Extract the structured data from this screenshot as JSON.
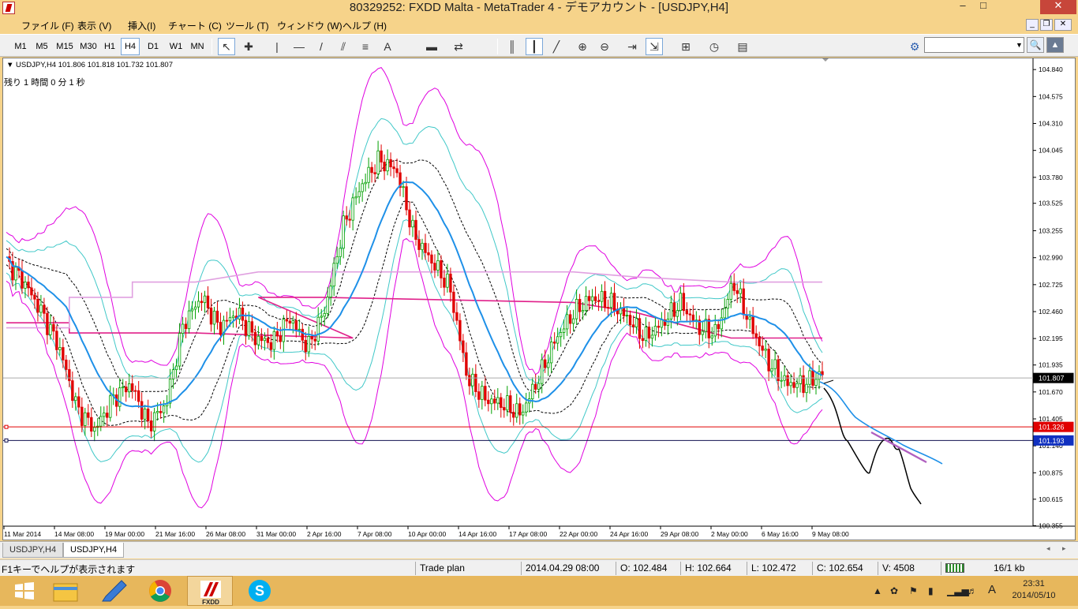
{
  "window": {
    "title": "80329252: FXDD Malta - MetaTrader 4 - デモアカウント - [USDJPY,H4]",
    "app_icon": "mt4-app-icon",
    "controls": {
      "minimize": "‒",
      "maximize": "□",
      "close": "✕",
      "restore": "⇅"
    }
  },
  "menu": {
    "items": [
      "ファイル (F)",
      "表示 (V)",
      "挿入(I)",
      "チャート (C)",
      "ツール (T)",
      "ウィンドウ (W)",
      "ヘルプ (H)"
    ],
    "mdi_controls": [
      "_",
      "❐",
      "✕"
    ]
  },
  "toolbar": {
    "timeframes": [
      "M1",
      "M5",
      "M15",
      "M30",
      "H1",
      "H4",
      "D1",
      "W1",
      "MN"
    ],
    "active_timeframe": "H4",
    "tools": [
      {
        "icon": "cursor-icon",
        "glyph": "↖"
      },
      {
        "icon": "crosshair-icon",
        "glyph": "✚"
      },
      {
        "icon": "vertical-line-icon",
        "glyph": "|"
      },
      {
        "icon": "horizontal-line-icon",
        "glyph": "—"
      },
      {
        "icon": "trendline-icon",
        "glyph": "/"
      },
      {
        "icon": "equidistant-channel-icon",
        "glyph": "⫽"
      },
      {
        "icon": "fibonacci-icon",
        "glyph": "≡"
      },
      {
        "icon": "text-icon",
        "glyph": "A"
      },
      {
        "icon": "text-label-icon",
        "glyph": "▬"
      },
      {
        "icon": "arrows-icon",
        "glyph": "⇄"
      }
    ],
    "chart_tools": [
      {
        "icon": "bar-chart-icon",
        "glyph": "║"
      },
      {
        "icon": "candlestick-icon",
        "glyph": "┃"
      },
      {
        "icon": "line-chart-icon",
        "glyph": "╱"
      },
      {
        "icon": "zoom-in-icon",
        "glyph": "⊕"
      },
      {
        "icon": "zoom-out-icon",
        "glyph": "⊖"
      },
      {
        "icon": "auto-scroll-icon",
        "glyph": "⇥"
      },
      {
        "icon": "chart-shift-icon",
        "glyph": "⇲"
      },
      {
        "icon": "indicators-icon",
        "glyph": "⊞"
      },
      {
        "icon": "periods-icon",
        "glyph": "◷"
      },
      {
        "icon": "templates-icon",
        "glyph": "▤"
      }
    ],
    "search_icon": "search-icon",
    "gear_icon": "gear-icon",
    "community_icon": "community-icon"
  },
  "chart": {
    "symbol_info": "USDJPY,H4  101.806 101.818 101.732 101.807",
    "countdown": "残り 1 時間 0 分 1 秒",
    "current_price_label": "101.807",
    "line_red_label": "101.326",
    "line_blue_label": "101.193",
    "colors": {
      "up": "#00a000",
      "down": "#e00000",
      "ma": "#1e90e8",
      "bb_outer": "#e000e0",
      "bb_mid": "#40c8c8",
      "bb_dash": "#000000",
      "flat_pink": "#e0208a",
      "flat_light": "#e0a0e0",
      "hline_red": "#e00000",
      "hline_blue": "#101050",
      "bid": "#aaaaaa"
    }
  },
  "chart_data": {
    "type": "candlestick",
    "title": "USDJPY,H4",
    "ylim": [
      100.35,
      104.95
    ],
    "y_ticks": [
      "104.840",
      "104.575",
      "104.310",
      "104.045",
      "103.780",
      "103.525",
      "103.255",
      "102.990",
      "102.725",
      "102.460",
      "102.195",
      "101.935",
      "101.670",
      "101.405",
      "101.140",
      "100.875",
      "100.615",
      "100.355"
    ],
    "x_labels": [
      "11 Mar 2014",
      "14 Mar 08:00",
      "19 Mar 00:00",
      "21 Mar 16:00",
      "26 Mar 08:00",
      "31 Mar 00:00",
      "2 Apr 16:00",
      "7 Apr 08:00",
      "10 Apr 00:00",
      "14 Apr 16:00",
      "17 Apr 08:00",
      "22 Apr 00:00",
      "24 Apr 16:00",
      "29 Apr 08:00",
      "2 May 00:00",
      "6 May 16:00",
      "9 May 08:00"
    ],
    "close_path": [
      102.95,
      102.75,
      102.45,
      102.1,
      101.5,
      101.3,
      101.6,
      101.75,
      101.35,
      101.55,
      102.35,
      102.6,
      102.3,
      102.45,
      102.2,
      102.15,
      102.4,
      102.1,
      102.5,
      103.3,
      103.7,
      103.95,
      103.85,
      103.2,
      102.95,
      102.7,
      101.8,
      101.6,
      101.55,
      101.45,
      101.8,
      102.2,
      102.45,
      102.6,
      102.55,
      102.4,
      102.2,
      102.35,
      102.55,
      102.3,
      102.25,
      102.75,
      102.3,
      101.95,
      101.75,
      101.75,
      101.85
    ],
    "series": [
      {
        "name": "101.807",
        "values": [
          101.807
        ]
      },
      {
        "name": "101.326",
        "values": [
          101.326
        ]
      },
      {
        "name": "101.193",
        "values": [
          101.193
        ]
      }
    ]
  },
  "tabs": {
    "items": [
      "USDJPY,H4",
      "USDJPY,H4"
    ],
    "active_index": 1,
    "arrows": [
      "◂",
      "▸"
    ]
  },
  "status": {
    "help": "F1キーでヘルプが表示されます",
    "profile": "Trade plan",
    "datetime": "2014.04.29 08:00",
    "open": "O: 102.484",
    "high": "H: 102.664",
    "low": "L: 102.472",
    "close": "C: 102.654",
    "volume": "V: 4508",
    "traffic": "16/1 kb"
  },
  "taskbar": {
    "apps": [
      {
        "name": "windows-start-icon"
      },
      {
        "name": "file-explorer-icon"
      },
      {
        "name": "pen-tool-icon"
      },
      {
        "name": "chrome-icon"
      },
      {
        "name": "fxdd-mt4-icon"
      },
      {
        "name": "skype-icon"
      }
    ],
    "fxdd_label": "FXDD",
    "clock_time": "23:31",
    "clock_date": "2014/05/10",
    "ime": "A"
  }
}
